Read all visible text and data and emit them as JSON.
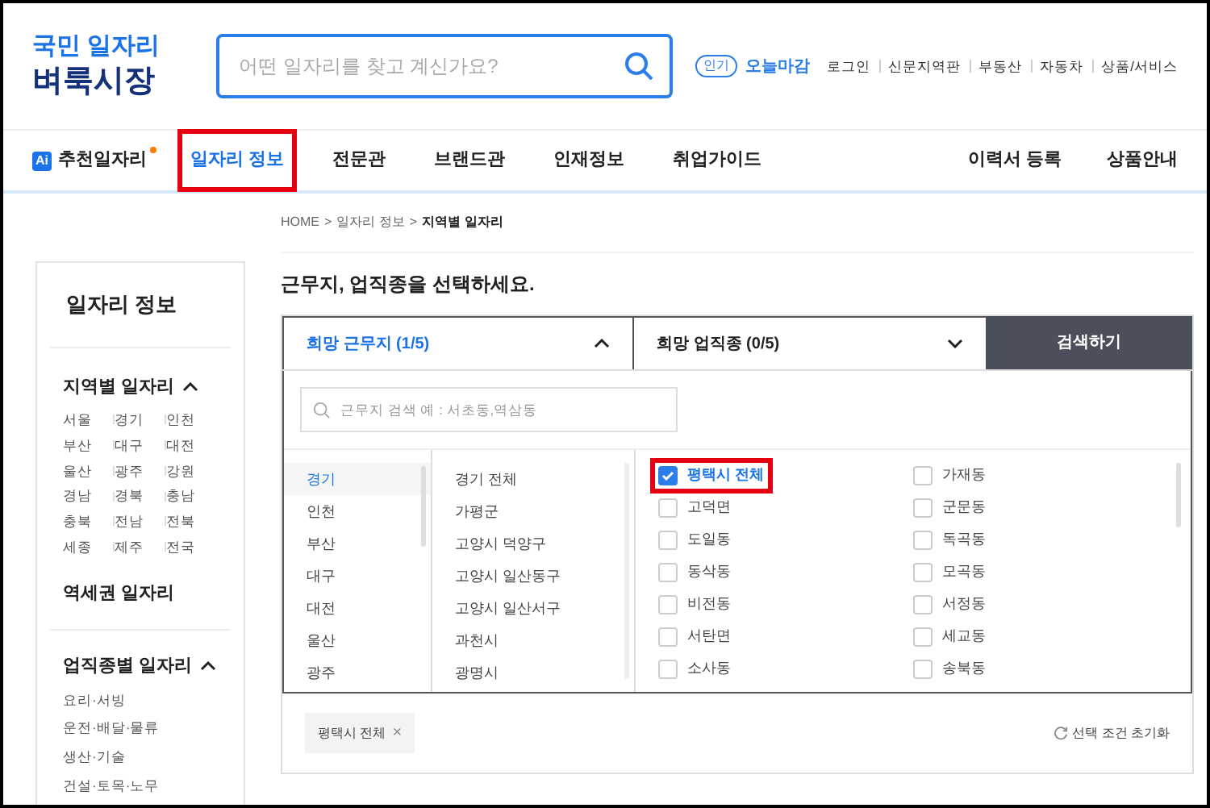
{
  "logo": {
    "line1": "국민 일자리",
    "line2": "벼룩시장"
  },
  "search": {
    "placeholder": "어떤 일자리를 찾고 계신가요?"
  },
  "popular": {
    "badge": "인기",
    "label": "오늘마감"
  },
  "top_links": [
    "로그인",
    "신문지역판",
    "부동산",
    "자동차",
    "상품/서비스"
  ],
  "nav": {
    "ai_badge": "Ai",
    "ai_label": "추천일자리",
    "items": [
      {
        "label": "일자리 정보",
        "selected": true,
        "highlighted": true
      },
      {
        "label": "전문관",
        "selected": false,
        "highlighted": false
      },
      {
        "label": "브랜드관",
        "selected": false,
        "highlighted": false
      },
      {
        "label": "인재정보",
        "selected": false,
        "highlighted": false
      },
      {
        "label": "취업가이드",
        "selected": false,
        "highlighted": false
      }
    ],
    "right": [
      "이력서 등록",
      "상품안내"
    ]
  },
  "breadcrumb": [
    "HOME",
    ">",
    "일자리 정보",
    ">",
    "지역별 일자리"
  ],
  "sidebar": {
    "title": "일자리 정보",
    "region_heading": "지역별 일자리",
    "regions": [
      "서울",
      "경기",
      "인천",
      "부산",
      "대구",
      "대전",
      "울산",
      "광주",
      "강원",
      "경남",
      "경북",
      "충남",
      "충북",
      "전남",
      "전북",
      "세종",
      "제주",
      "전국"
    ],
    "station": "역세권 일자리",
    "job_heading": "업직종별 일자리",
    "jobs": [
      "요리·서빙",
      "운전·배달·물류",
      "생산·기술",
      "건설·토목·노무"
    ]
  },
  "main": {
    "title": "근무지, 업직종을 선택하세요.",
    "location_tab": {
      "label": "희망 근무지 (1/5)",
      "expanded": true
    },
    "job_tab": {
      "label": "희망 업직종 (0/5)",
      "expanded": false
    },
    "search_button": "검색하기",
    "location_search": {
      "placeholder": "근무지 검색 예 : 서초동,역삼동"
    },
    "provinces": [
      {
        "label": "경기",
        "selected": true
      },
      {
        "label": "인천",
        "selected": false
      },
      {
        "label": "부산",
        "selected": false
      },
      {
        "label": "대구",
        "selected": false
      },
      {
        "label": "대전",
        "selected": false
      },
      {
        "label": "울산",
        "selected": false
      },
      {
        "label": "광주",
        "selected": false
      }
    ],
    "cities": [
      "경기 전체",
      "가평군",
      "고양시 덕양구",
      "고양시 일산동구",
      "고양시 일산서구",
      "과천시",
      "광명시"
    ],
    "districts": [
      {
        "label": "평택시 전체",
        "checked": true,
        "highlighted": true
      },
      {
        "label": "가재동",
        "checked": false,
        "highlighted": false
      },
      {
        "label": "고덕면",
        "checked": false,
        "highlighted": false
      },
      {
        "label": "군문동",
        "checked": false,
        "highlighted": false
      },
      {
        "label": "도일동",
        "checked": false,
        "highlighted": false
      },
      {
        "label": "독곡동",
        "checked": false,
        "highlighted": false
      },
      {
        "label": "동삭동",
        "checked": false,
        "highlighted": false
      },
      {
        "label": "모곡동",
        "checked": false,
        "highlighted": false
      },
      {
        "label": "비전동",
        "checked": false,
        "highlighted": false
      },
      {
        "label": "서정동",
        "checked": false,
        "highlighted": false
      },
      {
        "label": "서탄면",
        "checked": false,
        "highlighted": false
      },
      {
        "label": "세교동",
        "checked": false,
        "highlighted": false
      },
      {
        "label": "소사동",
        "checked": false,
        "highlighted": false
      },
      {
        "label": "송북동",
        "checked": false,
        "highlighted": false
      }
    ],
    "selected_tags": [
      {
        "label": "평택시 전체",
        "remove": "×"
      }
    ],
    "reset": "선택 조건 초기화"
  }
}
